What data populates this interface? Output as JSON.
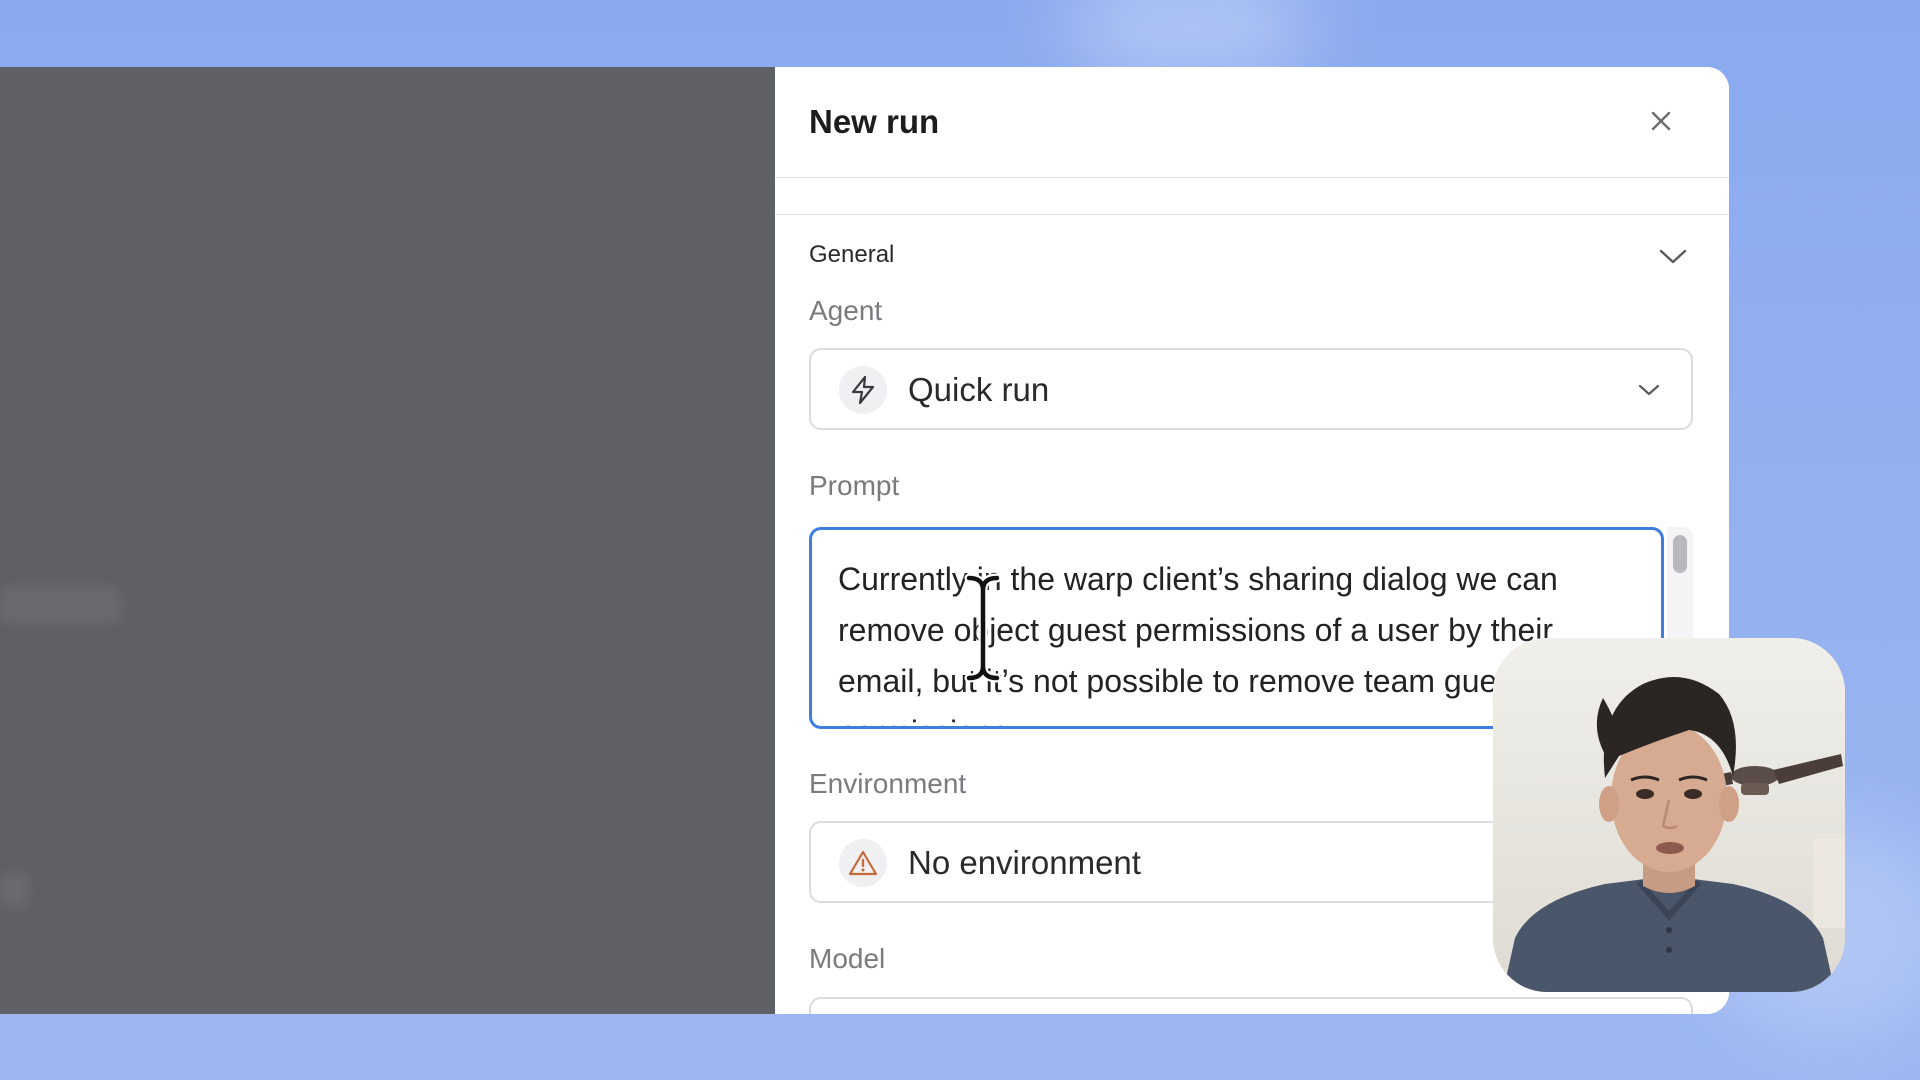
{
  "modal": {
    "title": "New run",
    "close_label": "×"
  },
  "general_section": {
    "title": "General"
  },
  "agent": {
    "label": "Agent",
    "value": "Quick run",
    "icon": "lightning-bolt-icon"
  },
  "prompt": {
    "label": "Prompt",
    "value": "Currently in the warp client’s sharing dialog we can remove object guest permissions of a user by their email, but it’s not possible to remove team guest permissions"
  },
  "environment": {
    "label": "Environment",
    "value": "No environment",
    "icon": "warning-triangle-icon"
  },
  "model": {
    "label": "Model"
  },
  "colors": {
    "background": "#8aa9ef",
    "accent_focus": "#3f7ee0",
    "overlay": "#5f6065",
    "warning": "#c46a3a"
  }
}
